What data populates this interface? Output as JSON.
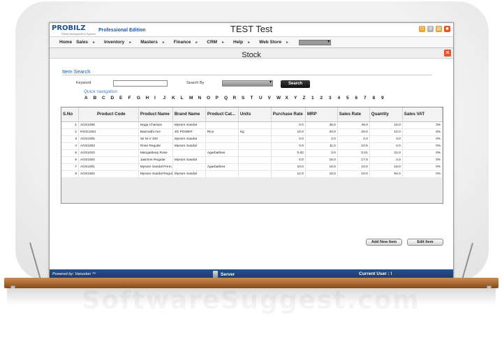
{
  "app": {
    "logo": "PROBILZ",
    "logo_sub": "Retail Management System",
    "edition": "Professional Edition",
    "title": "TEST Test"
  },
  "menu": [
    {
      "label": "Home"
    },
    {
      "label": "Sales"
    },
    {
      "label": "Inventory"
    },
    {
      "label": "Masters"
    },
    {
      "label": "Finance"
    },
    {
      "label": "CRM"
    },
    {
      "label": "Help"
    },
    {
      "label": "Web Store"
    }
  ],
  "menu_arrow": "►",
  "window": {
    "title": "Stock",
    "close_label": "✕"
  },
  "search": {
    "section_title": "Item Search",
    "keyword_label": "Keyword",
    "keyword_value": "",
    "search_by_label": "Search By",
    "search_by_value": "",
    "button_label": "Search",
    "quick_nav_label": "Quick navigation",
    "quick_nav": [
      "A",
      "B",
      "C",
      "D",
      "E",
      "F",
      "G",
      "H",
      "I",
      "J",
      "K",
      "L",
      "M",
      "N",
      "O",
      "P",
      "Q",
      "R",
      "S",
      "T",
      "U",
      "V",
      "W",
      "X",
      "Y",
      "Z",
      "1",
      "2",
      "3",
      "4",
      "5",
      "6",
      "7",
      "8",
      "9"
    ]
  },
  "table": {
    "columns": [
      "S.No",
      "Product Code",
      "Product Name",
      "Brand Name",
      "Product Cat...",
      "Units",
      "Purchase Rate",
      "MRP",
      "Sales Rate",
      "Quantity",
      "Sales VAT"
    ],
    "rows": [
      [
        "1",
        "AGS1006",
        "Naga Champa",
        "Mysore Sandal",
        "",
        "",
        "0.0",
        "45.0",
        "45.0",
        "15.0",
        "3%"
      ],
      [
        "2",
        "RICE1004",
        "Basmathi rice",
        "3G POWER",
        "Rice",
        "Kg",
        "10.0",
        "20.0",
        "20.0",
        "10.0",
        "5%"
      ],
      [
        "3",
        "AGS1005",
        "Sir M.V 100",
        "Mysore Sandal",
        "",
        "",
        "0.0",
        "3.0",
        "2.0",
        "3.0",
        "0%"
      ],
      [
        "4",
        "AGS1003",
        "Rose Regular",
        "Mysore Sandal",
        "",
        "",
        "0.0",
        "11.0",
        "10.5",
        "2.0",
        "0%"
      ],
      [
        "5",
        "AGS1010",
        "Mangaldeep Rose",
        "",
        "Agarbathies",
        "",
        "0.02",
        "3.0",
        "0.01",
        "21.0",
        "0%"
      ],
      [
        "6",
        "AGS1004",
        "Jasmine Regular",
        "Mysore Sandal",
        "",
        "",
        "0.0",
        "15.0",
        "17.0",
        "2.0",
        "0%"
      ],
      [
        "7",
        "AGS1001",
        "Mysore Sandal Prem...",
        "",
        "Agarbathies",
        "",
        "10.0",
        "10.0",
        "10.0",
        "18.0",
        "0%"
      ],
      [
        "8",
        "AGS1002",
        "Mysore Sandal Regular",
        "Mysore Sandal",
        "",
        "",
        "12.0",
        "10.0",
        "10.0",
        "94.0",
        "0%"
      ]
    ]
  },
  "actions": {
    "add_label": "Add New Item",
    "edit_label": "Edit Item"
  },
  "status": {
    "powered_by": "Powered by: Vanuston ™",
    "server": "Server",
    "current_user": "Current User :  !"
  },
  "watermark": "SoftwareSuggest.com",
  "colors": {
    "accent": "#1a56a8",
    "status_bar": "#1f4a86",
    "close": "#e8542a",
    "shelf": "#a5642e"
  }
}
